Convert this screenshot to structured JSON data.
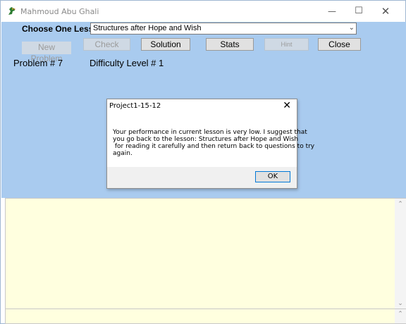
{
  "window": {
    "title": "Mahmoud Abu Ghali",
    "minimize_glyph": "—",
    "maximize_glyph": "☐",
    "close_glyph": "✕",
    "icon": "parrot-icon"
  },
  "form": {
    "lesson_label": "Choose One Lesson",
    "lesson_selected": "Structures after Hope and Wish",
    "buttons": {
      "new_problem": "New Problem",
      "check": "Check",
      "solution": "Solution",
      "stats": "Stats",
      "hint": "Hint",
      "close": "Close"
    },
    "problem": "Problem # 7",
    "difficulty": "Difficulty Level # 1"
  },
  "dialog": {
    "title": "Project1-15-12",
    "close_glyph": "✕",
    "message_lines": [
      "Your performance in current lesson is very low. I suggest that",
      "you go back to the lesson: Structures after Hope and Wish",
      " for reading it carefully and then return back to questions to try",
      "again."
    ],
    "ok_label": "OK"
  },
  "colors": {
    "form_bg": "#a9cbef",
    "text_area_bg": "#ffffdf",
    "dialog_accent": "#0078d7"
  }
}
